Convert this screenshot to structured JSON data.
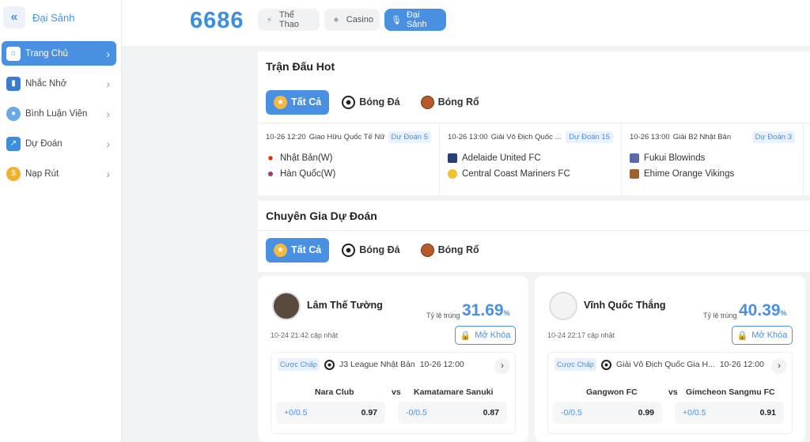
{
  "sidebar": {
    "title": "Đại Sảnh",
    "items": [
      {
        "label": "Trang Chủ",
        "icon": "home-icon"
      },
      {
        "label": "Nhắc Nhở",
        "icon": "bookmark-icon"
      },
      {
        "label": "Bình Luận Viên",
        "icon": "microphone-icon"
      },
      {
        "label": "Dự Đoán",
        "icon": "trend-chart-icon"
      },
      {
        "label": "Nạp Rút",
        "icon": "coin-icon"
      }
    ]
  },
  "header": {
    "logo": "6686",
    "tabs": [
      {
        "label": "Thể Thao",
        "icon": "lightning-icon"
      },
      {
        "label": "Casino",
        "icon": "spade-icon"
      },
      {
        "label": "Đại Sảnh",
        "icon": "microphone-icon"
      }
    ]
  },
  "hot": {
    "title": "Trận Đấu Hot",
    "tabs": [
      "Tất Cả",
      "Bóng Đá",
      "Bóng Rổ"
    ],
    "matches": [
      {
        "time": "10-26 12:20",
        "league": "Giao Hữu Quốc Tế Nữ",
        "badge": "Dự Đoán 5",
        "home": "Nhật Bản(W)",
        "away": "Hàn Quốc(W)"
      },
      {
        "time": "10-26 13:00",
        "league": "Giải Vô Địch Quốc ...",
        "badge": "Dự Đoán 15",
        "home": "Adelaide United FC",
        "away": "Central Coast Mariners FC"
      },
      {
        "time": "10-26 13:00",
        "league": "Giải B2 Nhật Bản",
        "badge": "Dự Đoán 3",
        "home": "Fukui Blowinds",
        "away": "Ehime Orange Vikings"
      }
    ]
  },
  "experts": {
    "title": "Chuyên Gia Dự Đoán",
    "tabs": [
      "Tất Cả",
      "Bóng Đá",
      "Bóng Rổ"
    ],
    "rate_label": "Tỷ lệ trúng",
    "pct": "%",
    "unlock_label": "Mở Khóa",
    "bet_label": "Cược Chấp",
    "vs": "vs",
    "cards": [
      {
        "name": "Lâm Thế Tường",
        "rate": "31.69",
        "updated": "10-24 21:42 cập nhật",
        "league": "J3 League Nhật Bản",
        "time": "10-26 12:00",
        "home": "Nara Club",
        "away": "Kamatamare Sanuki",
        "odds1_line": "+0/0.5",
        "odds1_val": "0.97",
        "odds2_line": "-0/0.5",
        "odds2_val": "0.87"
      },
      {
        "name": "Vĩnh Quốc Thắng",
        "rate": "40.39",
        "updated": "10-24 22:17 cập nhật",
        "league": "Giải Vô Địch Quốc Gia H...",
        "time": "10-26 12:00",
        "home": "Gangwon FC",
        "away": "Gimcheon Sangmu FC",
        "odds1_line": "-0/0.5",
        "odds1_val": "0.99",
        "odds2_line": "+0/0.5",
        "odds2_val": "0.91"
      }
    ]
  }
}
